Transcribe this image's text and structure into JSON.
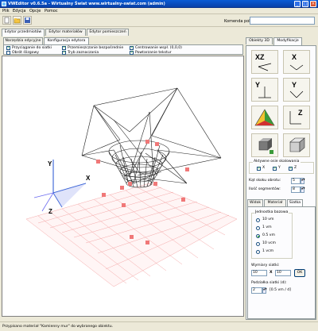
{
  "window": {
    "title": "VWEditor v0.6.5a - Wirtualny Świat www.wirtualny-swiat.com (admin)"
  },
  "menu": [
    "Plik",
    "Edycja",
    "Opcje",
    "Pomoc"
  ],
  "toolbar": {
    "command_label": "Komenda polecenia:",
    "command_value": ""
  },
  "main_tabs": [
    "Edytor przedmiotów",
    "Edytor materiałów",
    "Edytor pomieszczeń"
  ],
  "sub_tabs": [
    "Narzędzia edycyjne",
    "Konfiguracja edytora"
  ],
  "options": [
    {
      "label": "Przyciąganie do siatki",
      "checked": true
    },
    {
      "label": "Przemieszczanie bezpośrednie",
      "checked": true
    },
    {
      "label": "Centrowanie wspł. (0,0,0)",
      "checked": true
    },
    {
      "label": "Obrót ślizgowy",
      "checked": false
    },
    {
      "label": "Tryb zaznaczania",
      "checked": true
    },
    {
      "label": "Powtarzanie tekstur",
      "checked": true
    }
  ],
  "viewport": {
    "axis_labels": {
      "x": "X",
      "y": "Y",
      "z": "Z"
    }
  },
  "right_tabs": [
    "Obiekty 3D",
    "Modyfikacje"
  ],
  "axes_buttons": [
    "XZ",
    "X",
    "Y",
    "Y"
  ],
  "axis_section": {
    "title": "Aktywne osie skalowania",
    "axes": [
      {
        "label": "X",
        "checked": true
      },
      {
        "label": "Y",
        "checked": true
      },
      {
        "label": "Z",
        "checked": true
      }
    ],
    "rotation_label": "Kąt skoku obrotu:",
    "rotation_value": "5",
    "segments_label": "Ilość segmentów:",
    "segments_value": "8"
  },
  "bottom_tabs": [
    "Widok",
    "Materiał",
    "Siatka"
  ],
  "grid_unit": {
    "title": "Jednostka bazowa",
    "options": [
      {
        "label": "10 vm",
        "selected": false
      },
      {
        "label": "1 vm",
        "selected": false
      },
      {
        "label": "0.5 vm",
        "selected": true
      },
      {
        "label": "10 vcm",
        "selected": false
      },
      {
        "label": "1 vcm",
        "selected": false
      }
    ]
  },
  "grid_size": {
    "label": "Wymiary siatki:",
    "width": "10",
    "times": "X",
    "height": "10",
    "ok": "OK"
  },
  "grid_division": {
    "label": "Podziałka siatki (d):",
    "value": "2",
    "unit": "[0.5 vm / d]"
  },
  "status": {
    "text": "Przypisano materiał \"Kamienny mur\" do wybranego obiektu."
  },
  "colors": {
    "titlebar": "#0a5bd6",
    "face": "#ece9d8",
    "marker": "#f07878",
    "grid": "#f4a8a8"
  }
}
